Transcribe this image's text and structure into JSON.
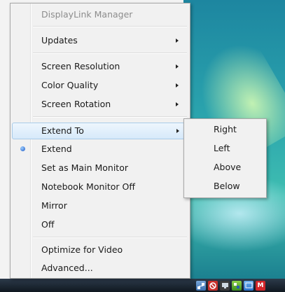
{
  "menu": {
    "header": "DisplayLink Manager",
    "updates": "Updates",
    "screen_resolution": "Screen Resolution",
    "color_quality": "Color Quality",
    "screen_rotation": "Screen Rotation",
    "extend_to": "Extend To",
    "extend": "Extend",
    "set_main": "Set as Main Monitor",
    "notebook_off": "Notebook Monitor Off",
    "mirror": "Mirror",
    "off": "Off",
    "optimize_video": "Optimize for Video",
    "advanced": "Advanced..."
  },
  "submenu": {
    "items": [
      "Right",
      "Left",
      "Above",
      "Below"
    ]
  },
  "tray": {
    "icons": [
      "network-icon",
      "stop-icon",
      "display-icon",
      "displaylink-icon",
      "monitor-icon",
      "m-icon"
    ],
    "m_label": "M"
  },
  "colors": {
    "highlight": "#d6e9fa",
    "radio": "#1b56c4",
    "desktop": "#2aa3ad"
  }
}
